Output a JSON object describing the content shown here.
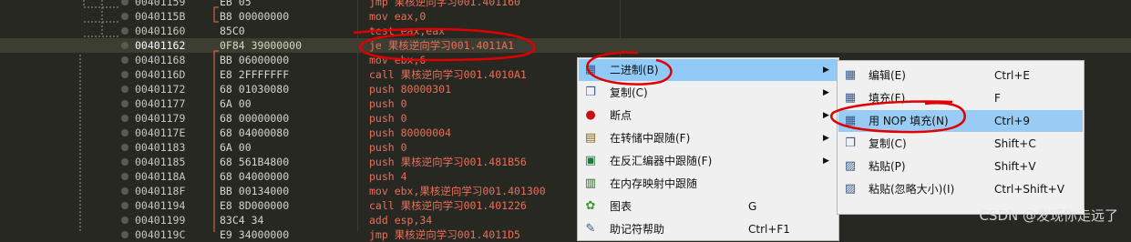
{
  "disasm": {
    "rows": [
      {
        "addr": "00401159",
        "bytes": "EB 05",
        "instr": "jmp 果核逆向学习001.401160"
      },
      {
        "addr": "0040115B",
        "bytes": "B8 00000000",
        "instr": "mov eax,0"
      },
      {
        "addr": "00401160",
        "bytes": "85C0",
        "instr": "test eax,eax"
      },
      {
        "addr": "00401162",
        "bytes": "0F84 39000000",
        "instr": "je 果核逆向学习001.4011A1"
      },
      {
        "addr": "00401168",
        "bytes": "BB 06000000",
        "instr": "mov ebx,6"
      },
      {
        "addr": "0040116D",
        "bytes": "E8 2FFFFFFF",
        "instr": "call 果核逆向学习001.4010A1"
      },
      {
        "addr": "00401172",
        "bytes": "68 01030080",
        "instr": "push 80000301"
      },
      {
        "addr": "00401177",
        "bytes": "6A 00",
        "instr": "push 0"
      },
      {
        "addr": "00401179",
        "bytes": "68 00000000",
        "instr": "push 0"
      },
      {
        "addr": "0040117E",
        "bytes": "68 04000080",
        "instr": "push 80000004"
      },
      {
        "addr": "00401183",
        "bytes": "6A 00",
        "instr": "push 0"
      },
      {
        "addr": "00401185",
        "bytes": "68 561B4800",
        "instr": "push 果核逆向学习001.481B56"
      },
      {
        "addr": "0040118A",
        "bytes": "68 04000000",
        "instr": "push 4"
      },
      {
        "addr": "0040118F",
        "bytes": "BB 00134000",
        "instr": "mov ebx,果核逆向学习001.401300"
      },
      {
        "addr": "00401194",
        "bytes": "E8 8D000000",
        "instr": "call 果核逆向学习001.401226"
      },
      {
        "addr": "00401199",
        "bytes": "83C4 34",
        "instr": "add esp,34"
      },
      {
        "addr": "0040119C",
        "bytes": "E9 34000000",
        "instr": "jmp 果核逆向学习001.4011D5"
      }
    ]
  },
  "context_menu": {
    "items": [
      {
        "label": "二进制(B)",
        "icon": "binary-icon",
        "shortcut": ""
      },
      {
        "label": "复制(C)",
        "icon": "copy-icon",
        "shortcut": ""
      },
      {
        "label": "断点",
        "icon": "breakpoint-icon",
        "shortcut": ""
      },
      {
        "label": "在转储中跟随(F)",
        "icon": "dump-icon",
        "shortcut": ""
      },
      {
        "label": "在反汇编器中跟随(F)",
        "icon": "disassembler-icon",
        "shortcut": ""
      },
      {
        "label": "在内存映射中跟随",
        "icon": "memory-map-icon",
        "shortcut": ""
      },
      {
        "label": "图表",
        "icon": "graph-icon",
        "shortcut": "G"
      },
      {
        "label": "助记符帮助",
        "icon": "help-icon",
        "shortcut": "Ctrl+F1"
      }
    ]
  },
  "submenu": {
    "items": [
      {
        "label": "编辑(E)",
        "icon": "edit-icon",
        "shortcut": "Ctrl+E"
      },
      {
        "label": "填充(F)...",
        "icon": "fill-icon",
        "shortcut": "F"
      },
      {
        "label": "用 NOP 填充(N)",
        "icon": "nop-fill-icon",
        "shortcut": "Ctrl+9"
      },
      {
        "label": "复制(C)",
        "icon": "copy-icon",
        "shortcut": "Shift+C"
      },
      {
        "label": "粘贴(P)",
        "icon": "paste-icon",
        "shortcut": "Shift+V"
      },
      {
        "label": "粘贴(忽略大小)(I)",
        "icon": "paste-ignore-size-icon",
        "shortcut": "Ctrl+Shift+V"
      }
    ]
  },
  "watermark": "CSDN @发现你走远了",
  "colors": {
    "background": "#272822",
    "instruction": "#e8705a",
    "highlight": "#91c9f7",
    "annotation": "#e00000"
  }
}
